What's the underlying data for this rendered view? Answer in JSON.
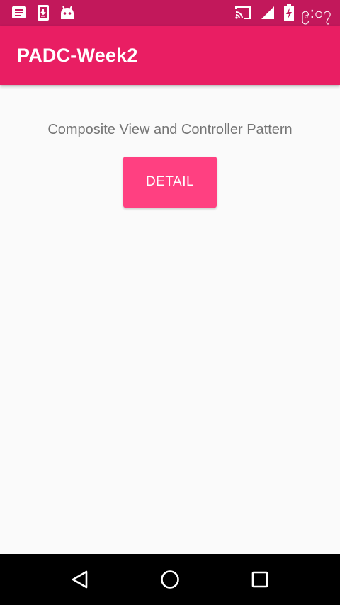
{
  "status_bar": {
    "time": "၉:၀၇",
    "left_icons": [
      "message-notification-icon",
      "download-notification-icon",
      "android-debug-icon"
    ],
    "right_icons": [
      "cast-icon",
      "cell-signal-icon",
      "battery-charging-icon"
    ]
  },
  "app_bar": {
    "title": "PADC-Week2"
  },
  "main": {
    "subtitle": "Composite View and Controller Pattern",
    "detail_button_label": "DETAIL"
  },
  "nav_bar": {
    "buttons": [
      "back-icon",
      "home-icon",
      "recents-icon"
    ]
  },
  "colors": {
    "status_bar": "#c2185b",
    "app_bar": "#e91e63",
    "accent_button": "#ff4081",
    "background": "#fafafa",
    "subtitle_text": "#757575",
    "nav_bar": "#000000"
  }
}
